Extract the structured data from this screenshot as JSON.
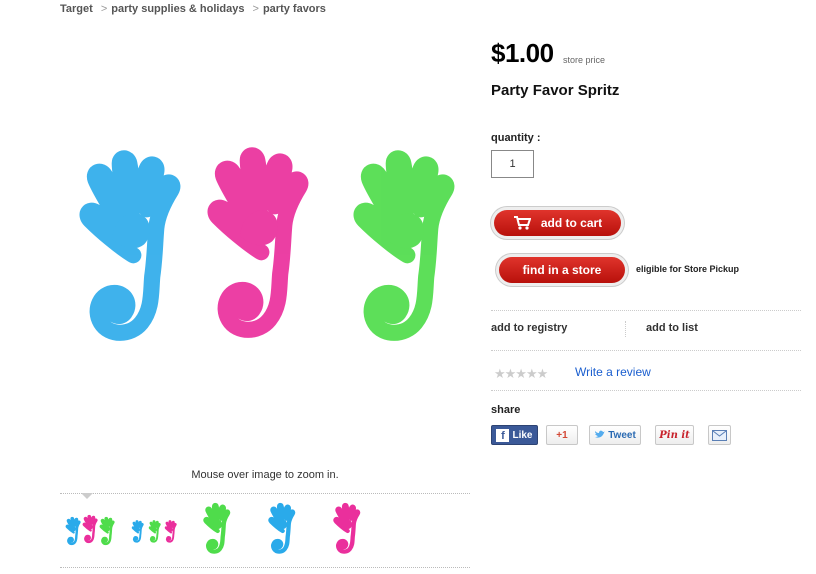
{
  "breadcrumb": {
    "items": [
      "Target",
      "party supplies & holidays",
      "party favors"
    ],
    "separator": ">"
  },
  "product": {
    "price": "$1.00",
    "price_note": "store price",
    "title": "Party Favor Spritz",
    "quantity_label": "quantity :",
    "quantity_value": "1"
  },
  "actions": {
    "add_to_cart": "add to cart",
    "find_in_store": "find in a store",
    "store_pickup": "eligible for Store Pickup",
    "add_to_registry": "add to registry",
    "add_to_list": "add to list",
    "write_review": "Write a review",
    "stars": "★★★★★"
  },
  "share": {
    "label": "share",
    "facebook": "Like",
    "gplus": "+1",
    "twitter": "Tweet",
    "pinterest": "Pin it"
  },
  "gallery": {
    "zoom_hint": "Mouse over image to zoom in."
  },
  "colors": {
    "blue_hand": "#29a9e6",
    "pink_hand": "#ea2f9c",
    "green_hand": "#4fd84a",
    "primary_red": "#cc1f16",
    "link_blue": "#1a5ecf"
  }
}
